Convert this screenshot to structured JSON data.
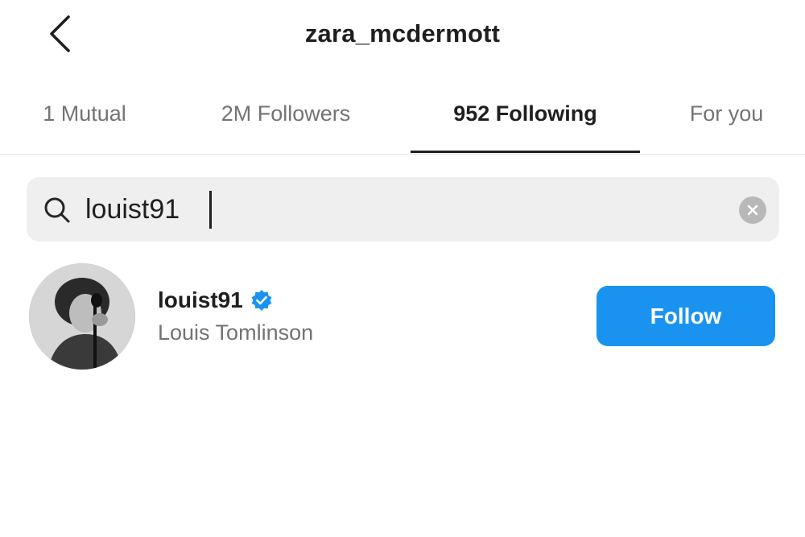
{
  "header": {
    "title": "zara_mcdermott",
    "back_icon": "chevron-left-icon"
  },
  "tabs": [
    {
      "label": "1 Mutual",
      "active": false
    },
    {
      "label": "2M Followers",
      "active": false
    },
    {
      "label": "952 Following",
      "active": true
    },
    {
      "label": "For you",
      "active": false
    }
  ],
  "search": {
    "value": "louist91",
    "icon": "search-icon",
    "clear_icon": "clear-icon"
  },
  "results": [
    {
      "username": "louist91",
      "full_name": "Louis Tomlinson",
      "verified": true,
      "follow_label": "Follow"
    }
  ],
  "colors": {
    "accent": "#1a93f0",
    "verified_badge": "#1a93f0",
    "search_bg": "#efefef"
  }
}
